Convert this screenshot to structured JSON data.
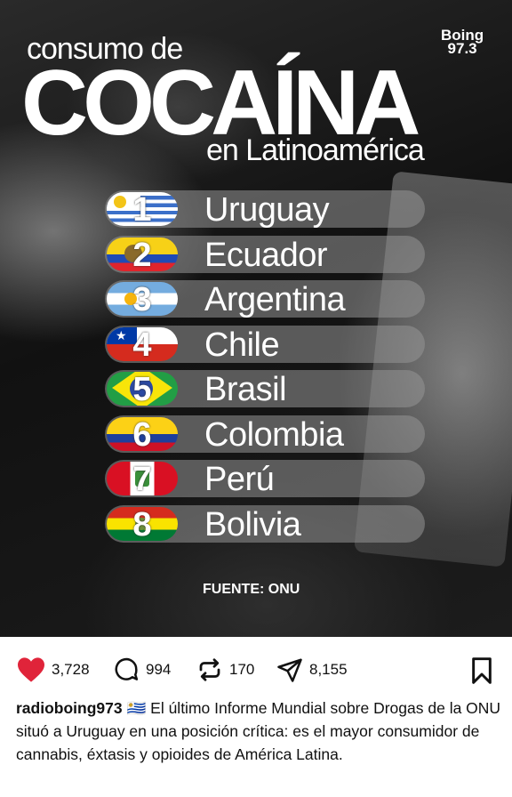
{
  "post": {
    "headline_small": "consumo de",
    "headline_big": "COCAÍNA",
    "headline_sub": "en Latinoamérica",
    "logo_line1": "Boing",
    "logo_line2": "97.3",
    "source": "FUENTE: ONU",
    "ranking": [
      {
        "rank": "1",
        "country": "Uruguay",
        "flag": "uruguay"
      },
      {
        "rank": "2",
        "country": "Ecuador",
        "flag": "ecuador"
      },
      {
        "rank": "3",
        "country": "Argentina",
        "flag": "argentina"
      },
      {
        "rank": "4",
        "country": "Chile",
        "flag": "chile"
      },
      {
        "rank": "5",
        "country": "Brasil",
        "flag": "brasil"
      },
      {
        "rank": "6",
        "country": "Colombia",
        "flag": "colombia"
      },
      {
        "rank": "7",
        "country": "Perú",
        "flag": "peru"
      },
      {
        "rank": "8",
        "country": "Bolivia",
        "flag": "bolivia"
      }
    ]
  },
  "actions": {
    "likes": "3,728",
    "comments": "994",
    "reposts": "170",
    "shares": "8,155"
  },
  "caption": {
    "username": "radioboing973",
    "flag_emoji": "🇺🇾",
    "text": "El último Informe Mundial sobre Drogas de la ONU situó a Uruguay en una posición crítica: es el mayor consumidor de cannabis, éxtasis y opioides de América Latina."
  },
  "colors": {
    "like": "#e0243a",
    "text": "#111111"
  }
}
